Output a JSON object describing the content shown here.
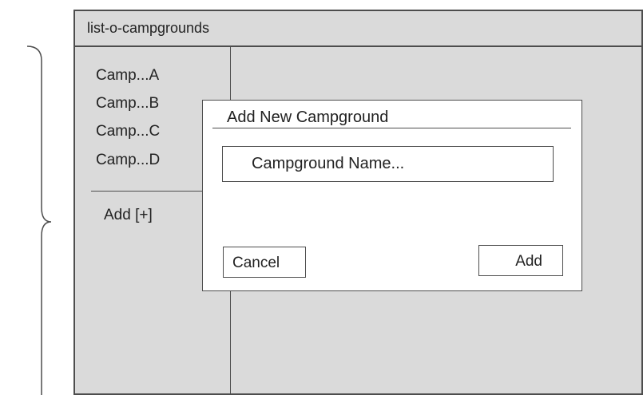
{
  "window": {
    "title": "list-o-campgrounds"
  },
  "sidebar": {
    "items": [
      {
        "label": "Camp...A"
      },
      {
        "label": "Camp...B"
      },
      {
        "label": "Camp...C"
      },
      {
        "label": "Camp...D"
      }
    ],
    "add_label": "Add [+]"
  },
  "dialog": {
    "title": "Add New Campground",
    "name_placeholder": "Campground Name...",
    "cancel_label": "Cancel",
    "add_label": "Add"
  }
}
